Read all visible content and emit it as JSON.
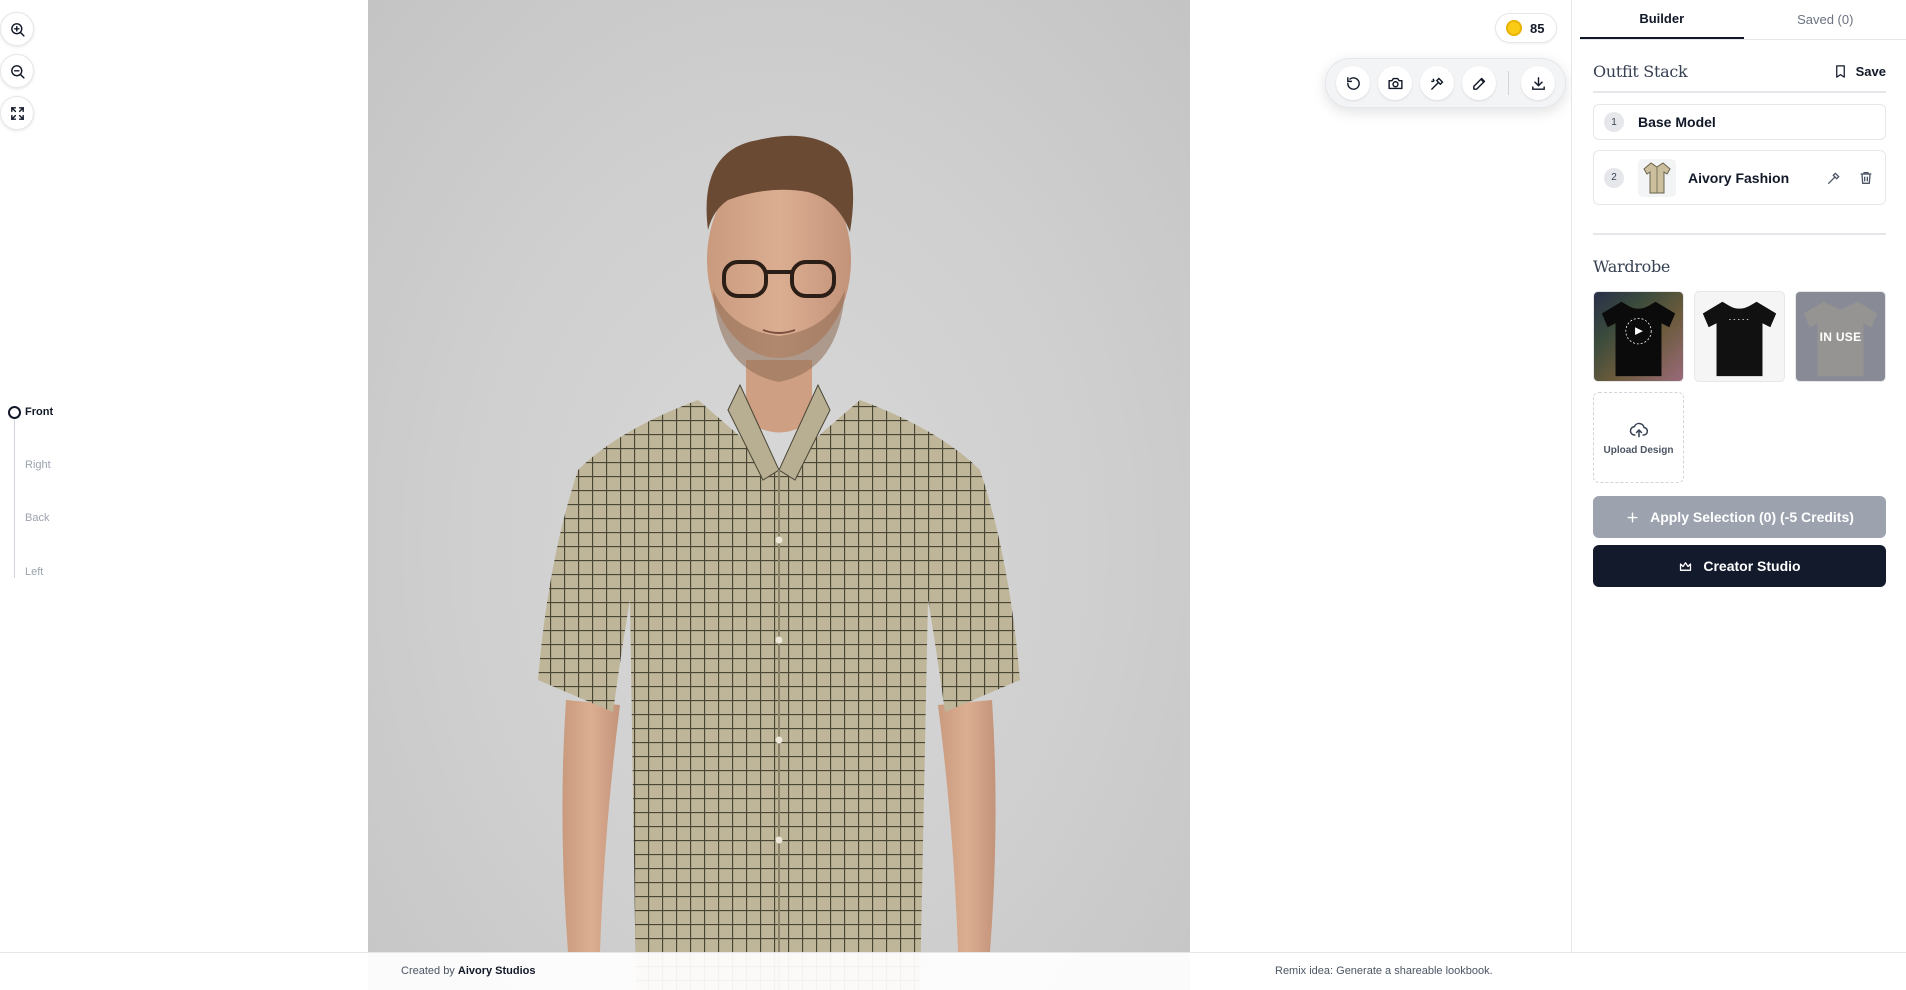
{
  "credits": {
    "count": "85",
    "icon": "coin-icon",
    "color": "#facc15"
  },
  "zoom_tools": [
    "zoom-in-icon",
    "zoom-out-icon",
    "fullscreen-icon"
  ],
  "views": {
    "active": "Front",
    "items": [
      "Front",
      "Right",
      "Back",
      "Left"
    ]
  },
  "toolbar": {
    "icons": [
      "undo-icon",
      "camera-icon",
      "edit-tool-icon",
      "pencil-icon",
      "download-icon"
    ]
  },
  "panel": {
    "tabs": [
      {
        "label": "Builder",
        "active": true
      },
      {
        "label": "Saved (0)",
        "active": false
      }
    ],
    "outfit_stack": {
      "title": "Outfit Stack",
      "save_label": "Save",
      "items": [
        {
          "number": "1",
          "label": "Base Model"
        },
        {
          "number": "2",
          "label": "Aivory Fashion"
        }
      ]
    },
    "wardrobe": {
      "title": "Wardrobe",
      "in_use_label": "IN USE",
      "upload_label": "Upload Design"
    },
    "apply_button": "Apply Selection (0) (-5 Credits)",
    "studio_button": "Creator Studio"
  },
  "footer": {
    "created_prefix": "Created by ",
    "created_brand": "Aivory Studios",
    "remix": "Remix idea: Generate a shareable lookbook."
  },
  "colors": {
    "primary_dark": "#121a2b",
    "disabled": "#9ca3af",
    "accent_coin": "#facc15"
  }
}
